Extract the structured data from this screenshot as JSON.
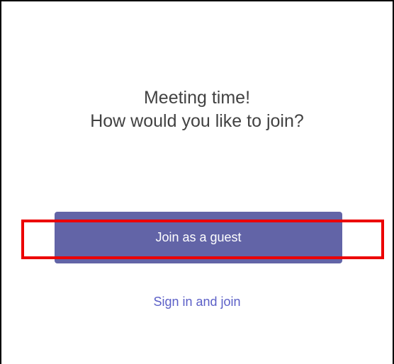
{
  "prompt": {
    "line1": "Meeting time!",
    "line2": "How would you like to join?"
  },
  "actions": {
    "join_guest_label": "Join as a guest",
    "sign_in_label": "Sign in and join"
  },
  "colors": {
    "accent": "#6264a7",
    "link": "#5b5fc7",
    "highlight": "#ec0000",
    "text": "#424242"
  }
}
